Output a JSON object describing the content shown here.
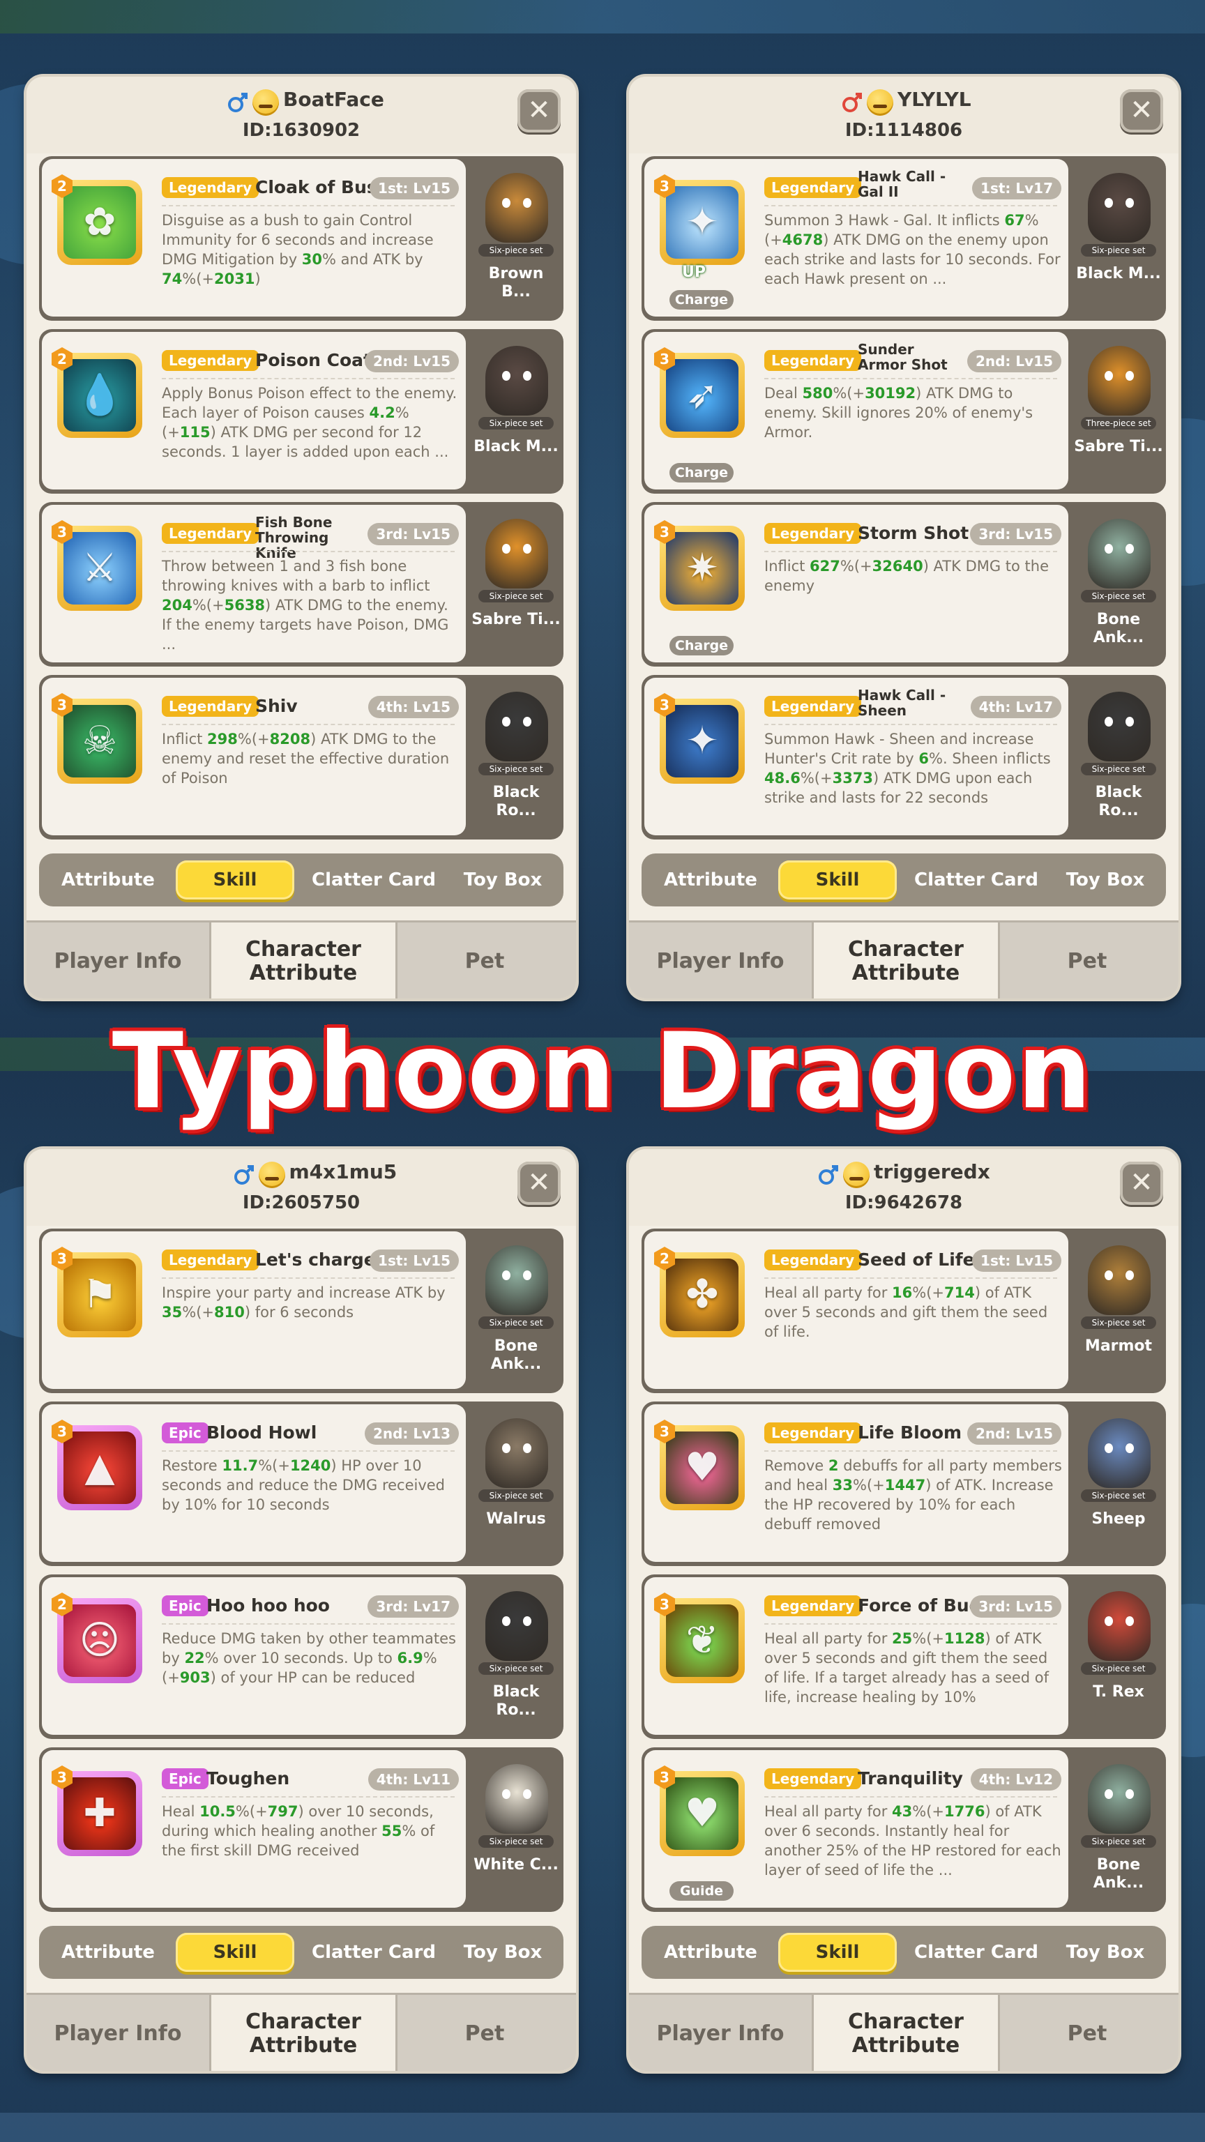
{
  "banner": {
    "title": "Typhoon Dragon"
  },
  "ui": {
    "close_label": "✕",
    "tabs": [
      "Attribute",
      "Skill",
      "Clatter Card",
      "Toy Box"
    ],
    "nav": [
      "Player Info",
      "Character Attribute",
      "Pet"
    ],
    "set_labels": {
      "six": "Six-piece set",
      "three": "Three-piece set"
    }
  },
  "panels": [
    {
      "player_name": "BoatFace",
      "player_id": "ID:1630902",
      "gender_icon": "male-icon",
      "cards": [
        {
          "rarity": "Legendary",
          "name": "Cloak of Bush",
          "slot": "1st: Lv15",
          "level": "2",
          "desc": "Disguise as a bush to gain Control Immunity for 6 seconds and increase DMG Mitigation by <b>30</b>% and ATK by <b>74</b>%(+<b>2031</b>)",
          "pet": "Brown B...",
          "set": "six",
          "icon": "bush-icon"
        },
        {
          "rarity": "Legendary",
          "name": "Poison Coat",
          "slot": "2nd: Lv15",
          "level": "2",
          "desc": "Apply Bonus Poison effect to the enemy. Each layer of Poison causes <b>4.2</b>%(+<b>115</b>) ATK DMG per second for 12 seconds. 1 layer is added upon each ...",
          "pet": "Black M...",
          "set": "six",
          "icon": "poison-drop-icon"
        },
        {
          "rarity": "Legendary",
          "name": "Fish Bone Throwing Knife",
          "slot": "3rd: Lv15",
          "level": "3",
          "desc": "Throw between 1 and 3 fish bone throwing knives with a barb to inflict <b>204</b>%(+<b>5638</b>) ATK DMG to the enemy. If the enemy targets have Poison, DMG ...",
          "pet": "Sabre Ti...",
          "set": "six",
          "icon": "fish-bone-icon"
        },
        {
          "rarity": "Legendary",
          "name": "Shiv",
          "slot": "4th: Lv15",
          "level": "3",
          "desc": "Inflict <b>298</b>%(+<b>8208</b>) ATK DMG to the enemy and reset the effective duration of Poison",
          "pet": "Black Ro...",
          "set": "six",
          "icon": "skull-icon"
        }
      ],
      "active_tab": 1
    },
    {
      "player_name": "YLYLYL",
      "player_id": "ID:1114806",
      "gender_icon": "female-icon",
      "cards": [
        {
          "rarity": "Legendary",
          "name": "Hawk Call - Gal II",
          "slot": "1st: Lv17",
          "level": "3",
          "desc": "Summon 3 Hawk - Gal. It inflicts <b>67</b>%(+<b>4678</b>) ATK DMG on the enemy upon each strike and lasts for 10 seconds. For each Hawk present on ...",
          "pet": "Black M...",
          "set": "six",
          "icon": "hawk-icon",
          "tag": "Charge",
          "up": "UP"
        },
        {
          "rarity": "Legendary",
          "name": "Sunder Armor Shot",
          "slot": "2nd: Lv15",
          "level": "3",
          "desc": "Deal <b>580</b>%(+<b>30192</b>) ATK DMG to enemy. Skill ignores 20% of enemy's Armor.",
          "pet": "Sabre Ti...",
          "set": "three",
          "icon": "arrow-shot-icon",
          "tag": "Charge"
        },
        {
          "rarity": "Legendary",
          "name": "Storm Shot",
          "slot": "3rd: Lv15",
          "level": "3",
          "desc": "Inflict <b>627</b>%(+<b>32640</b>) ATK DMG to the enemy",
          "pet": "Bone Ank...",
          "set": "six",
          "icon": "storm-arrow-icon",
          "tag": "Charge"
        },
        {
          "rarity": "Legendary",
          "name": "Hawk Call - Sheen",
          "slot": "4th: Lv17",
          "level": "3",
          "desc": "Summon Hawk - Sheen and increase Hunter's Crit rate by <b>6</b>%. Sheen inflicts <b>48.6</b>%(+<b>3373</b>) ATK DMG upon each strike and lasts for 22 seconds",
          "pet": "Black Ro...",
          "set": "six",
          "icon": "dark-hawk-icon"
        }
      ],
      "active_tab": 1
    },
    {
      "player_name": "m4x1mu5",
      "player_id": "ID:2605750",
      "gender_icon": "male-icon",
      "cards": [
        {
          "rarity": "Legendary",
          "name": "Let's charge",
          "slot": "1st: Lv15",
          "level": "3",
          "desc": "Inspire your party and increase ATK by <b>35</b>%(+<b>810</b>) for 6 seconds",
          "pet": "Bone Ank...",
          "set": "six",
          "icon": "charge-banner-icon"
        },
        {
          "rarity": "Epic",
          "name": "Blood Howl",
          "slot": "2nd: Lv13",
          "level": "3",
          "desc": "Restore <b>11.7</b>%(+<b>1240</b>) HP over 10 seconds and reduce the DMG received by 10% for 10 seconds",
          "pet": "Walrus",
          "set": "six",
          "icon": "blood-drop-icon"
        },
        {
          "rarity": "Epic",
          "name": "Hoo hoo hoo",
          "slot": "3rd: Lv17",
          "level": "2",
          "desc": "Reduce DMG taken by other teammates by <b>22</b>% over 10 seconds. Up to <b>6.9</b>%(+<b>903</b>) of your HP can be reduced",
          "pet": "Black Ro...",
          "set": "six",
          "icon": "shout-face-icon"
        },
        {
          "rarity": "Epic",
          "name": "Toughen",
          "slot": "4th: Lv11",
          "level": "3",
          "desc": "Heal <b>10.5</b>%(+<b>797</b>) over 10 seconds, during which healing another <b>55</b>% of the first skill DMG received",
          "pet": "White C...",
          "set": "six",
          "icon": "toughen-figure-icon"
        }
      ],
      "active_tab": 1
    },
    {
      "player_name": "triggeredx",
      "player_id": "ID:9642678",
      "gender_icon": "male-icon",
      "cards": [
        {
          "rarity": "Legendary",
          "name": "Seed of Life",
          "slot": "1st: Lv15",
          "level": "2",
          "desc": "Heal all party for <b>16</b>%(+<b>714</b>) of ATK over 5 seconds and gift them the seed of life.",
          "pet": "Marmot",
          "set": "six",
          "icon": "seed-icon"
        },
        {
          "rarity": "Legendary",
          "name": "Life Bloom",
          "slot": "2nd: Lv15",
          "level": "3",
          "desc": "Remove <b>2</b> debuffs for all party members and heal <b>33</b>%(+<b>1447</b>) of ATK. Increase the HP recovered by 10% for each debuff removed",
          "pet": "Sheep",
          "set": "six",
          "icon": "heart-bloom-icon"
        },
        {
          "rarity": "Legendary",
          "name": "Force of Bud",
          "slot": "3rd: Lv15",
          "level": "3",
          "desc": "Heal all party for <b>25</b>%(+<b>1128</b>) of ATK over 5 seconds and gift them the seed of life. If a target already has a seed of life, increase healing by 10%",
          "pet": "T. Rex",
          "set": "six",
          "icon": "sprout-icon"
        },
        {
          "rarity": "Legendary",
          "name": "Tranquility",
          "slot": "4th: Lv12",
          "level": "3",
          "desc": "Heal all party for <b>43</b>%(+<b>1776</b>) of ATK over 6 seconds. Instantly heal for another 25% of the HP restored for each layer of seed of life the ...",
          "pet": "Bone Ank...",
          "set": "six",
          "icon": "green-heart-icon",
          "tag": "Guide"
        }
      ],
      "active_tab": 1
    }
  ],
  "colors": {
    "legendary": "#f2b41a",
    "epic": "#d35bd8",
    "highlight_number": "#2a9a2a",
    "active_tab": "#fcd938",
    "banner_outline": "#e01b1b"
  }
}
